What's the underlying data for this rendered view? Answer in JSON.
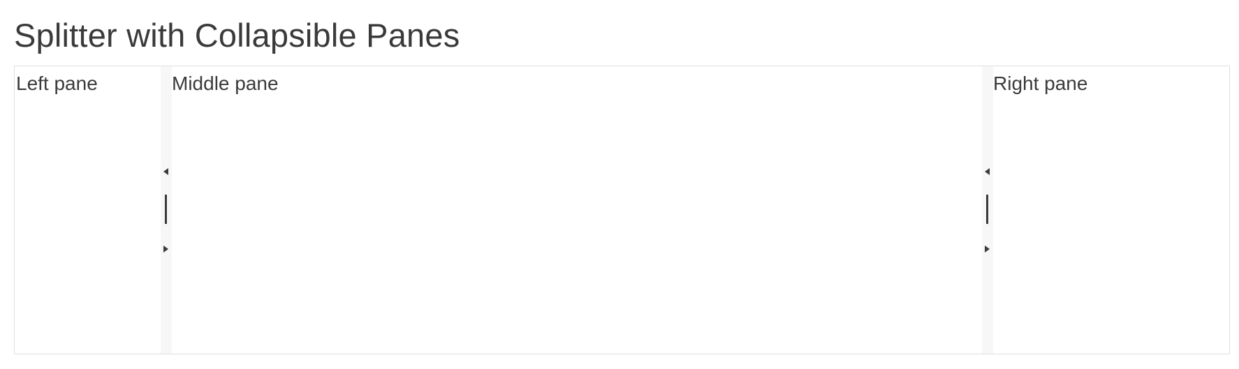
{
  "page": {
    "title": "Splitter with Collapsible Panes"
  },
  "splitter": {
    "panes": [
      {
        "label": "Left pane"
      },
      {
        "label": "Middle pane"
      },
      {
        "label": "Right pane"
      }
    ],
    "split_bars": [
      {
        "collapse_icon": "triangle-left-icon",
        "expand_icon": "triangle-right-icon",
        "handle_icon": "resize-handle-icon"
      },
      {
        "collapse_icon": "triangle-left-icon",
        "expand_icon": "triangle-right-icon",
        "handle_icon": "resize-handle-icon"
      }
    ]
  },
  "colors": {
    "text": "#3a3a3a",
    "border": "#dedede",
    "split_bar": "#f7f7f7",
    "background": "#ffffff"
  }
}
